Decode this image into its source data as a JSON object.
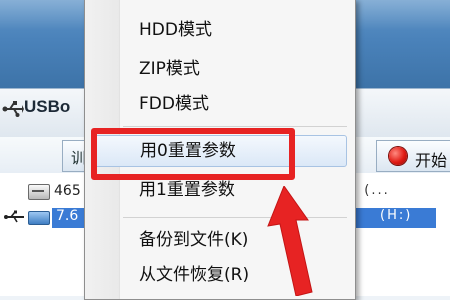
{
  "app": {
    "title": "USBo"
  },
  "toolbar": {
    "left_button_glyph": "训",
    "start_label": "开始"
  },
  "menu": {
    "items": [
      {
        "label": "HDD模式"
      },
      {
        "label": "ZIP模式"
      },
      {
        "label": "FDD模式"
      },
      {
        "label": "用0重置参数",
        "highlighted": true
      },
      {
        "label": "用1重置参数"
      },
      {
        "label": "备份到文件(K)"
      },
      {
        "label": "从文件恢复(R)"
      }
    ]
  },
  "tree": {
    "rows": [
      {
        "text": "465",
        "tail": ". (...",
        "icon": "hdd-icon"
      },
      {
        "text": "7.6",
        "tail": "(H:)",
        "icon": "usb-drive-icon",
        "selected": true
      }
    ]
  },
  "annotation": {
    "box_color": "#e72323",
    "arrow_color": "#e72323"
  },
  "colors": {
    "titlebar": "#4a82ba",
    "selection": "#3a7bd5",
    "start_dot": "#e01a13"
  }
}
